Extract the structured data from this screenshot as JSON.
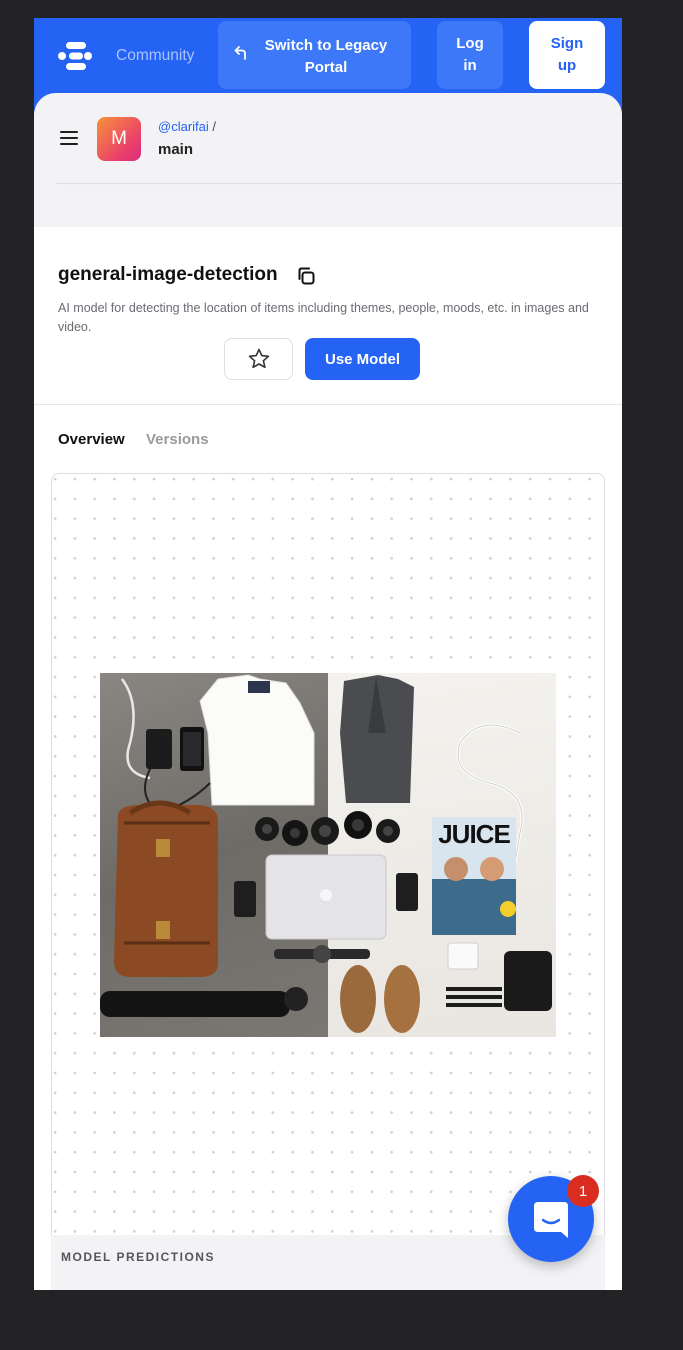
{
  "nav": {
    "community_label": "Community",
    "legacy_label": "Switch to Legacy Portal",
    "login_label": "Log in",
    "signup_label": "Sign up"
  },
  "header": {
    "avatar_letter": "M",
    "owner": "@clarifai",
    "separator": "/",
    "app_name": "main"
  },
  "model": {
    "title": "general-image-detection",
    "description": "AI model for detecting the location of items including themes, people, moods, etc. in images and video.",
    "use_model_label": "Use Model"
  },
  "tabs": [
    {
      "label": "Overview",
      "active": true
    },
    {
      "label": "Versions",
      "active": false
    }
  ],
  "preview": {
    "magazine_title": "JUICE"
  },
  "predictions": {
    "label": "MODEL PREDICTIONS"
  },
  "chat": {
    "badge_count": "1"
  },
  "colors": {
    "brand_blue": "#2563f5",
    "page_bg": "#232325",
    "badge_red": "#d92d20"
  },
  "icons": [
    "clarifai-logo-icon",
    "undo-arrow-icon",
    "hamburger-menu-icon",
    "copy-icon",
    "star-icon",
    "chat-icon"
  ]
}
